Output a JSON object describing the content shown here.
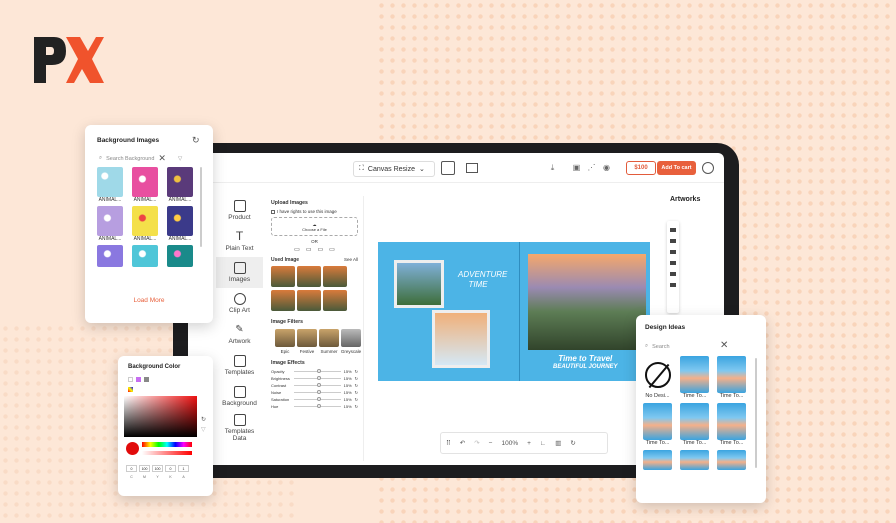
{
  "brand": {
    "logo_text": "PX"
  },
  "toolbar": {
    "canvas_resize": "Canvas Resize",
    "price": "$100",
    "add_to_cart": "Add To cart"
  },
  "sidebar": {
    "items": [
      {
        "label": "Product",
        "icon": "cube-icon"
      },
      {
        "label": "Plain Text",
        "icon": "text-icon"
      },
      {
        "label": "Images",
        "icon": "image-icon"
      },
      {
        "label": "Clip Art",
        "icon": "smiley-icon"
      },
      {
        "label": "Artwork",
        "icon": "brush-icon"
      },
      {
        "label": "Templates",
        "icon": "template-icon"
      },
      {
        "label": "Background",
        "icon": "background-icon"
      },
      {
        "label": "Templates Data",
        "icon": "data-icon"
      }
    ]
  },
  "images_panel": {
    "upload_title": "Upload Images",
    "rights": "I have rights to use this image",
    "choose": "Choose a File",
    "or": "OR",
    "used_title": "Used Image",
    "see_all": "See All",
    "filters_title": "Image Filters",
    "filters": [
      "Epic",
      "Festive",
      "Summer",
      "Greyscale"
    ],
    "effects_title": "Image Effects",
    "effects": [
      {
        "name": "Opacity",
        "value": "15%"
      },
      {
        "name": "Brightness",
        "value": "15%"
      },
      {
        "name": "Contrast",
        "value": "15%"
      },
      {
        "name": "Noise",
        "value": "15%"
      },
      {
        "name": "Saturation",
        "value": "15%"
      },
      {
        "name": "Hue",
        "value": "15%"
      }
    ]
  },
  "canvas": {
    "text_left": "ADVENTURE TIME",
    "text_right_1": "Time to Travel",
    "text_right_2": "BEAUTIFUL JOURNEY"
  },
  "artworks": {
    "title": "Artworks"
  },
  "zoom": {
    "value": "100%"
  },
  "background_images": {
    "title": "Background Images",
    "search_placeholder": "Search Background",
    "items": [
      "ANIMAL...",
      "ANIMAL...",
      "ANIMAL...",
      "ANIMAL...",
      "ANIMAL...",
      "ANIMAL...",
      "",
      "",
      ""
    ],
    "load_more": "Load More"
  },
  "background_color": {
    "title": "Background Color",
    "fields": [
      "0",
      "100",
      "100",
      "0",
      "1"
    ],
    "field_labels": [
      "C",
      "M",
      "Y",
      "K",
      "A"
    ]
  },
  "design_ideas": {
    "title": "Design Ideas",
    "search_placeholder": "Search",
    "items": [
      "No Desi...",
      "Time To...",
      "Time To...",
      "Time To...",
      "Time To...",
      "Time To...",
      "",
      "",
      ""
    ]
  },
  "colors": {
    "accent": "#e8603c",
    "canvas": "#4cb4e6",
    "logo_dark": "#222222",
    "logo_orange": "#f0532c"
  }
}
